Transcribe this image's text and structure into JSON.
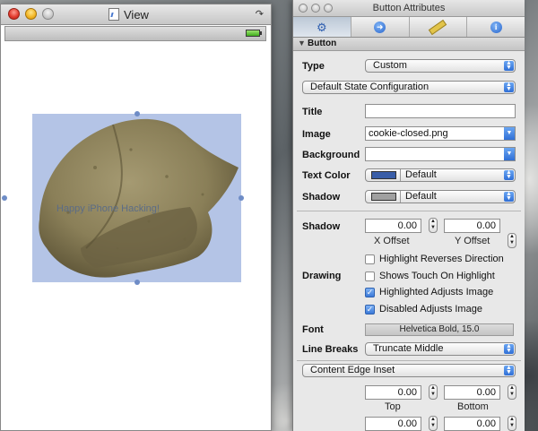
{
  "view_window": {
    "title": "View",
    "button_title": "Happy iPhone Hacking!"
  },
  "inspector": {
    "title": "Button Attributes",
    "tabs": [
      {
        "icon": "sliders-icon"
      },
      {
        "icon": "arrow-circle-icon"
      },
      {
        "icon": "ruler-icon"
      },
      {
        "icon": "info-icon"
      }
    ],
    "section": "Button",
    "type_label": "Type",
    "type_value": "Custom",
    "state_config": "Default State Configuration",
    "title_label": "Title",
    "title_value": "",
    "image_label": "Image",
    "image_value": "cookie-closed.png",
    "background_label": "Background",
    "background_value": "",
    "text_color_label": "Text Color",
    "text_color_value": "Default",
    "text_color_swatch": "#3a5ea8",
    "shadow_label": "Shadow",
    "shadow_value": "Default",
    "shadow_swatch": "#a0a0a0",
    "shadow_offset_label": "Shadow",
    "shadow_x": "0.00",
    "shadow_y": "0.00",
    "x_offset_label": "X Offset",
    "y_offset_label": "Y Offset",
    "drawing_label": "Drawing",
    "checkboxes": [
      {
        "label": "Highlight Reverses Direction",
        "checked": false
      },
      {
        "label": "Shows Touch On Highlight",
        "checked": false
      },
      {
        "label": "Highlighted Adjusts Image",
        "checked": true
      },
      {
        "label": "Disabled Adjusts Image",
        "checked": true
      }
    ],
    "font_label": "Font",
    "font_value": "Helvetica Bold, 15.0",
    "line_breaks_label": "Line Breaks",
    "line_breaks_value": "Truncate Middle",
    "content_edge": "Content Edge Inset",
    "inset_top": "0.00",
    "inset_bottom": "0.00",
    "top_label": "Top",
    "bottom_label": "Bottom",
    "inset_left": "0.00",
    "inset_right": "0.00"
  }
}
